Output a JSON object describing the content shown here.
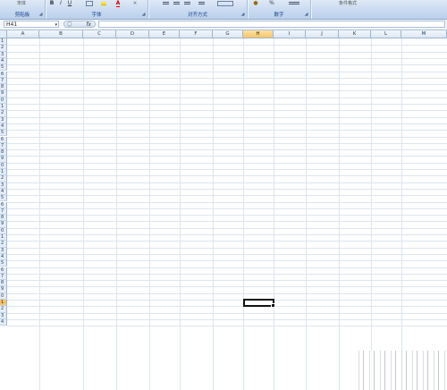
{
  "ribbon": {
    "groups": [
      {
        "label": "剪贴板"
      },
      {
        "label": "字体"
      },
      {
        "label": "对齐方式"
      },
      {
        "label": "数字"
      }
    ],
    "font_buttons": {
      "bold": "B",
      "italic": "I",
      "underline": "U",
      "font_color": "A"
    },
    "percent": "%",
    "launcher_glyph": "◢",
    "partial_labels": {
      "top_left_text": "宋体",
      "top_right_text": "条件格式"
    }
  },
  "formula_bar": {
    "name_box": "H41",
    "name_box_dropdown": "▾",
    "fx_label": "fx",
    "formula_value": ""
  },
  "columns": [
    "A",
    "B",
    "C",
    "D",
    "E",
    "F",
    "G",
    "H",
    "I",
    "J",
    "K",
    "L",
    "M"
  ],
  "selected_column": "H",
  "rows": [
    "1",
    "2",
    "3",
    "4",
    "5",
    "6",
    "7",
    "8",
    "9",
    "0",
    "1",
    "2",
    "3",
    "4",
    "5",
    "6",
    "7",
    "8",
    "9",
    "0",
    "1",
    "2",
    "3",
    "4",
    "5",
    "6",
    "7",
    "8",
    "9",
    "0",
    "1",
    "2",
    "3",
    "4",
    "5",
    "6",
    "7",
    "8",
    "9",
    "0",
    "1",
    "2",
    "3",
    "4"
  ],
  "selected_row_index": 40,
  "active_cell": "H41",
  "colors": {
    "header_bg": "#e4ecf7",
    "selected_header": "#f8c46a",
    "grid_line": "#dde5ee",
    "ribbon_text": "#15428b"
  }
}
